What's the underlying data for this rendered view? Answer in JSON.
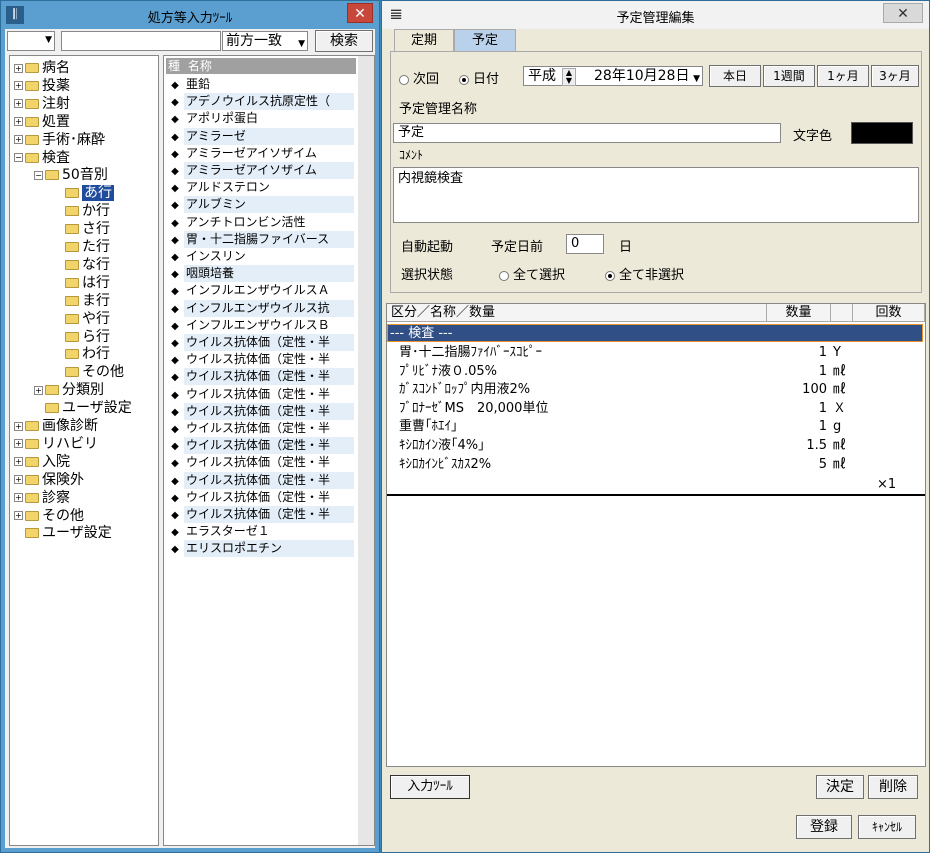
{
  "left_window": {
    "title": "処方等入力ﾂｰﾙ",
    "close": "✕",
    "search": {
      "value": "",
      "match_mode": "前方一致",
      "search_button": "検索"
    },
    "tree": [
      {
        "label": "病名",
        "level": 0,
        "expander": "+"
      },
      {
        "label": "投薬",
        "level": 0,
        "expander": "+"
      },
      {
        "label": "注射",
        "level": 0,
        "expander": "+"
      },
      {
        "label": "処置",
        "level": 0,
        "expander": "+"
      },
      {
        "label": "手術･麻酔",
        "level": 0,
        "expander": "+"
      },
      {
        "label": "検査",
        "level": 0,
        "expander": "−"
      },
      {
        "label": "50音別",
        "level": 1,
        "expander": "−"
      },
      {
        "label": "あ行",
        "level": 2,
        "expander": "",
        "selected": true
      },
      {
        "label": "か行",
        "level": 2,
        "expander": ""
      },
      {
        "label": "さ行",
        "level": 2,
        "expander": ""
      },
      {
        "label": "た行",
        "level": 2,
        "expander": ""
      },
      {
        "label": "な行",
        "level": 2,
        "expander": ""
      },
      {
        "label": "は行",
        "level": 2,
        "expander": ""
      },
      {
        "label": "ま行",
        "level": 2,
        "expander": ""
      },
      {
        "label": "や行",
        "level": 2,
        "expander": ""
      },
      {
        "label": "ら行",
        "level": 2,
        "expander": ""
      },
      {
        "label": "わ行",
        "level": 2,
        "expander": ""
      },
      {
        "label": "その他",
        "level": 2,
        "expander": ""
      },
      {
        "label": "分類別",
        "level": 1,
        "expander": "+"
      },
      {
        "label": "ユーザ設定",
        "level": 1,
        "expander": ""
      },
      {
        "label": "画像診断",
        "level": 0,
        "expander": "+"
      },
      {
        "label": "リハビリ",
        "level": 0,
        "expander": "+"
      },
      {
        "label": "入院",
        "level": 0,
        "expander": "+"
      },
      {
        "label": "保険外",
        "level": 0,
        "expander": "+"
      },
      {
        "label": "診察",
        "level": 0,
        "expander": "+"
      },
      {
        "label": "その他",
        "level": 0,
        "expander": "+"
      },
      {
        "label": "ユーザ設定",
        "level": 0,
        "expander": ""
      }
    ],
    "list_header": {
      "kind": "種",
      "name": "名称"
    },
    "list_items": [
      "亜鉛",
      "アデノウイルス抗原定性（",
      "アポリポ蛋白",
      "アミラーゼ",
      "アミラーゼアイソザイム",
      "アミラーゼアイソザイム",
      "アルドステロン",
      "アルブミン",
      "アンチトロンビン活性",
      "胃・十二指腸ファイバース",
      "インスリン",
      "咽頭培養",
      "インフルエンザウイルスＡ",
      "インフルエンザウイルス抗",
      "インフルエンザウイルスＢ",
      "ウイルス抗体価（定性・半",
      "ウイルス抗体価（定性・半",
      "ウイルス抗体価（定性・半",
      "ウイルス抗体価（定性・半",
      "ウイルス抗体価（定性・半",
      "ウイルス抗体価（定性・半",
      "ウイルス抗体価（定性・半",
      "ウイルス抗体価（定性・半",
      "ウイルス抗体価（定性・半",
      "ウイルス抗体価（定性・半",
      "ウイルス抗体価（定性・半",
      "エラスターゼ１",
      "エリスロポエチン"
    ],
    "bullet": "◆"
  },
  "right_window": {
    "title": "予定管理編集",
    "close": "✕",
    "tabs": [
      "定期",
      "予定"
    ],
    "active_tab": 1,
    "mode_next": "次回",
    "mode_date": "日付",
    "era": "平成",
    "date": "28年10月28日",
    "btn_today": "本日",
    "btn_week": "1週間",
    "btn_month": "1ヶ月",
    "btn_3month": "3ヶ月",
    "name_label": "予定管理名称",
    "name_value": "予定",
    "text_color_label": "文字色",
    "text_color": "#000000",
    "comment_label": "ｺﾒﾝﾄ",
    "comment_value": "内視鏡検査",
    "auto_label": "自動起動",
    "days_before_label": "予定日前",
    "days_before_value": "0",
    "days_unit": "日",
    "select_state_label": "選択状態",
    "select_all": "全て選択",
    "deselect_all": "全て非選択",
    "grid_headers": {
      "name": "区分／名称／数量",
      "qty": "数量",
      "times": "回数"
    },
    "group_row": "--- 検査 ---",
    "rows": [
      {
        "name": "胃･十二指腸ﾌｧｲﾊﾞｰｽｺﾋﾟｰ",
        "qty": "1",
        "unit": "Y"
      },
      {
        "name": "ﾌﾟﾘﾋﾞﾅ液０.05%",
        "qty": "1",
        "unit": "㎖"
      },
      {
        "name": "ｶﾞｽｺﾝﾄﾞﾛｯﾌﾟ内用液2%",
        "qty": "100",
        "unit": "㎖"
      },
      {
        "name": "ﾌﾞﾛﾅｰｾﾞMS　20,000単位",
        "qty": "1",
        "unit": "Ｘ"
      },
      {
        "name": "重曹｢ﾎｴｲ｣",
        "qty": "1",
        "unit": "g"
      },
      {
        "name": "ｷｼﾛｶｲﾝ液｢4%｣",
        "qty": "1.5",
        "unit": "㎖"
      },
      {
        "name": "ｷｼﾛｶｲﾝﾋﾞｽｶｽ2%",
        "qty": "5",
        "unit": "㎖"
      }
    ],
    "times_value": "×1",
    "btn_input_tool": "入力ﾂｰﾙ",
    "btn_decide": "決定",
    "btn_delete": "削除",
    "btn_register": "登録",
    "btn_cancel": "ｷｬﾝｾﾙ"
  }
}
